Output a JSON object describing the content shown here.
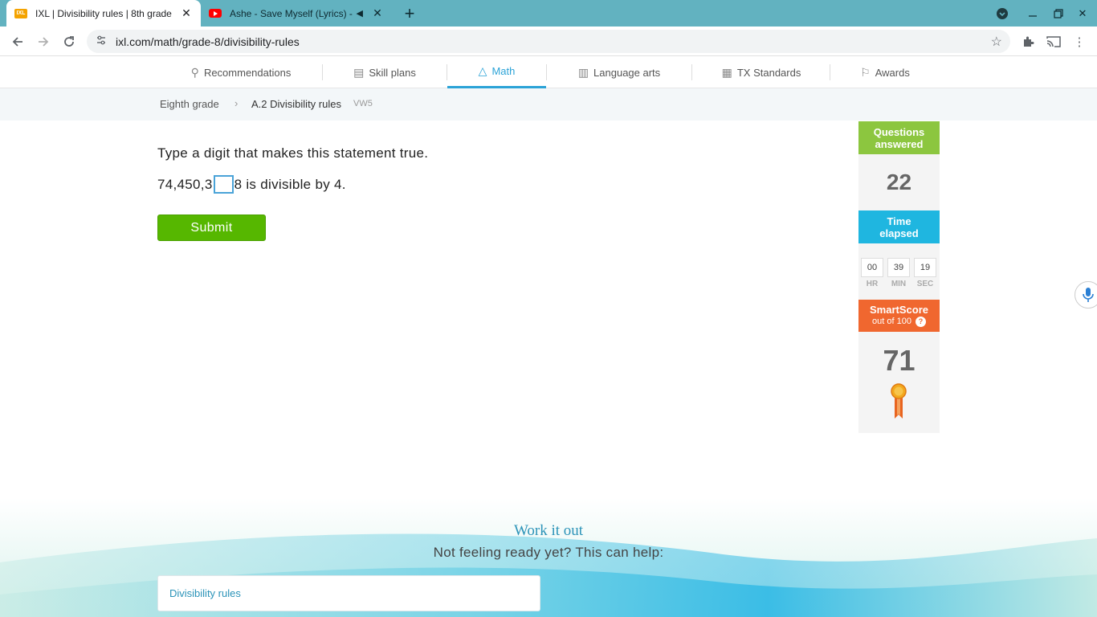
{
  "browser": {
    "tabs": [
      {
        "title": "IXL | Divisibility rules | 8th grade",
        "favicon": "ixl-favicon",
        "active": true
      },
      {
        "title": "Ashe - Save Myself (Lyrics) -",
        "favicon": "youtube-favicon",
        "active": false,
        "audio": true
      }
    ],
    "url": "ixl.com/math/grade-8/divisibility-rules"
  },
  "nav": {
    "items": [
      {
        "label": "Recommendations",
        "icon": "recommendations-icon"
      },
      {
        "label": "Skill plans",
        "icon": "skill-plans-icon"
      },
      {
        "label": "Math",
        "icon": "math-icon",
        "active": true
      },
      {
        "label": "Language arts",
        "icon": "language-arts-icon"
      },
      {
        "label": "TX Standards",
        "icon": "standards-icon"
      },
      {
        "label": "Awards",
        "icon": "awards-icon"
      }
    ]
  },
  "breadcrumb": {
    "grade": "Eighth grade",
    "skill": "A.2 Divisibility rules",
    "code": "VW5"
  },
  "question": {
    "prompt": "Type a digit that makes this statement true.",
    "before": "74,450,3",
    "after": "8 is divisible by 4.",
    "submit_label": "Submit"
  },
  "stats": {
    "questions_header": [
      "Questions",
      "answered"
    ],
    "questions_answered": "22",
    "time_header": [
      "Time",
      "elapsed"
    ],
    "time": {
      "hr": "00",
      "min": "39",
      "sec": "19"
    },
    "time_labels": {
      "hr": "HR",
      "min": "MIN",
      "sec": "SEC"
    },
    "smartscore_title": "SmartScore",
    "smartscore_sub": "out of 100",
    "smartscore": "71"
  },
  "work": {
    "title": "Work it out",
    "subtitle": "Not feeling ready yet? This can help:",
    "links": [
      "Divisibility rules"
    ]
  },
  "colors": {
    "accent": "#2ba3d7",
    "submit": "#56b700",
    "questions_header": "#8cc63f",
    "time_header": "#1fb6e0",
    "smartscore_header": "#f0672f"
  }
}
